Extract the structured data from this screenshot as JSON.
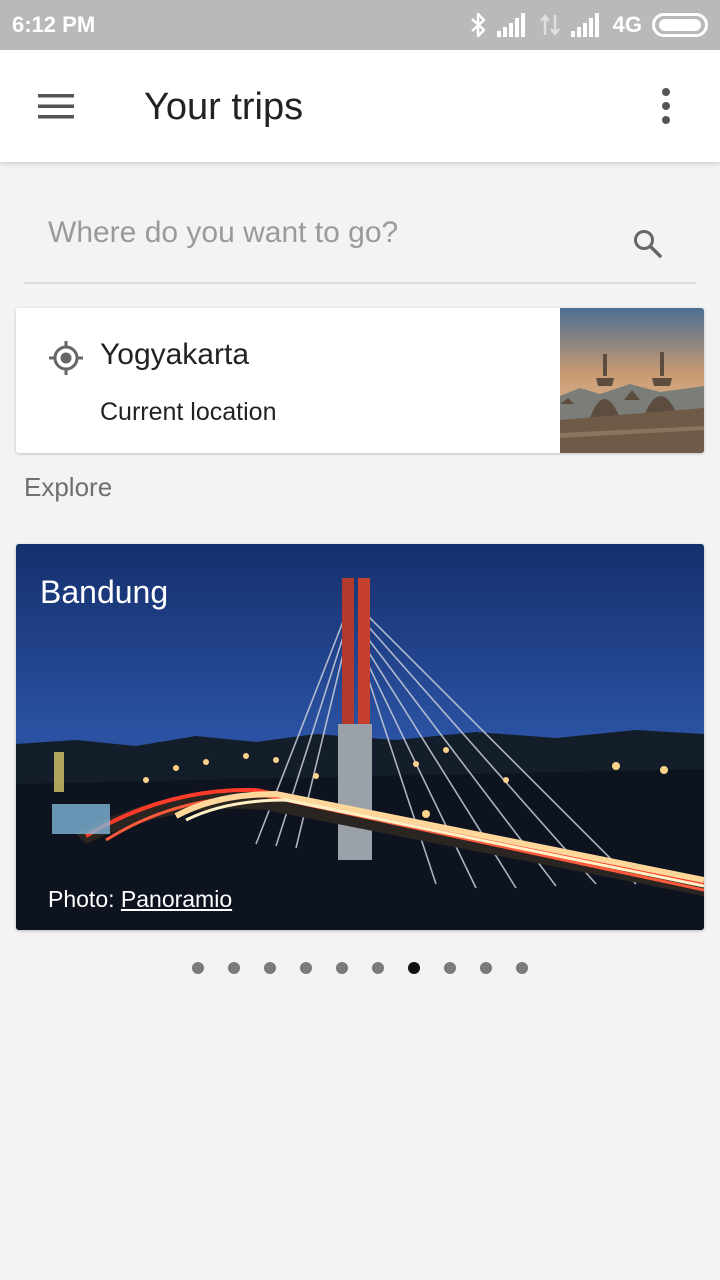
{
  "status_bar": {
    "time": "6:12 PM",
    "network": "4G",
    "icons": [
      "bluetooth-icon",
      "signal-icon",
      "data-transfer-icon",
      "signal-icon",
      "battery-icon"
    ]
  },
  "app_bar": {
    "title": "Your trips",
    "menu_icon": "hamburger-menu-icon",
    "more_icon": "more-vert-icon"
  },
  "search": {
    "placeholder": "Where do you want to go?",
    "icon": "search-icon"
  },
  "current_location_card": {
    "city": "Yogyakarta",
    "label": "Current location",
    "icon": "my-location-icon",
    "thumbnail": "temple-stupa-photo"
  },
  "explore": {
    "heading": "Explore",
    "featured": {
      "place": "Bandung",
      "credit_prefix": "Photo:",
      "credit_link": "Panoramio"
    },
    "carousel": {
      "count": 10,
      "active_index": 6
    }
  },
  "colors": {
    "status_bar": "#b9b9b9",
    "background": "#f3f3f3",
    "active_dot": "#111111",
    "inactive_dot": "#7a7a7a"
  }
}
